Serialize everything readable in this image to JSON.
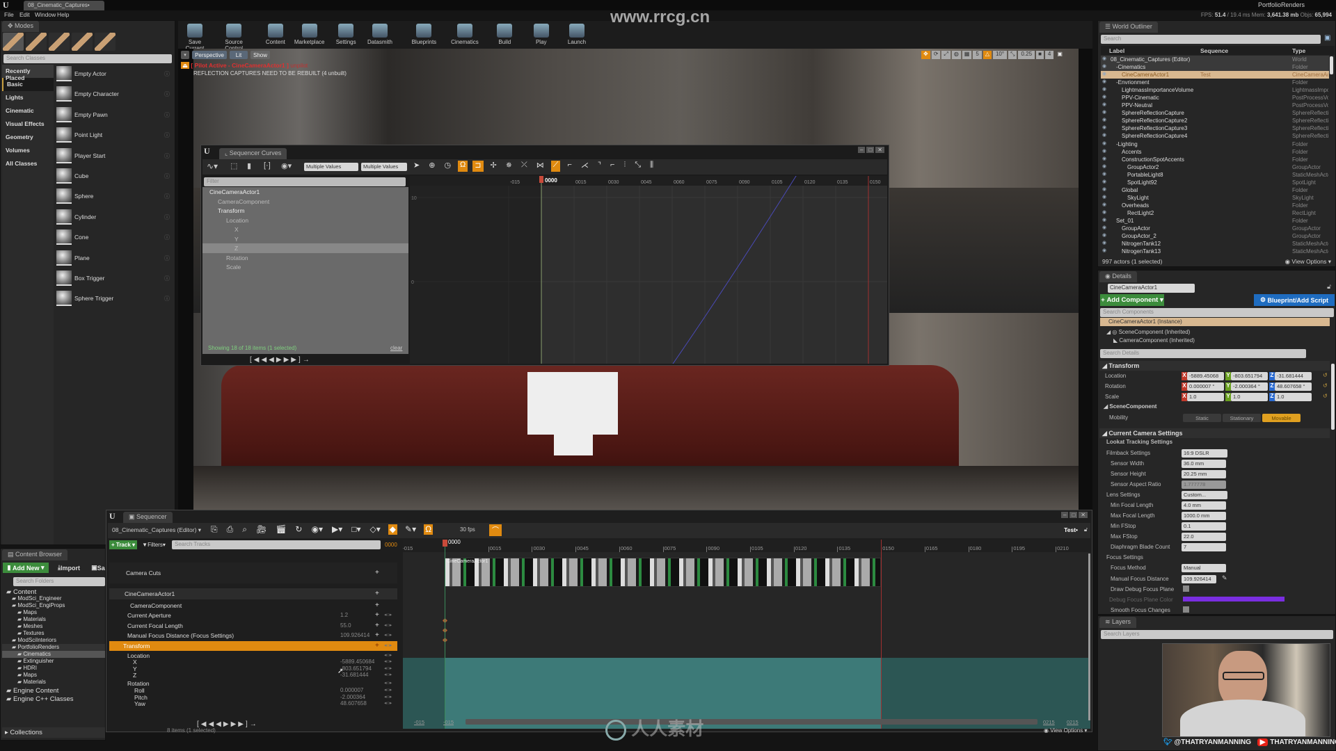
{
  "app": {
    "level_tab": "08_Cinematic_Captures•",
    "project": "PortfolioRenders",
    "watermark_url": "www.rrcg.cn",
    "watermark_brand": "人人素材",
    "stats": {
      "fps_label": "FPS:",
      "fps": "51.4",
      "ms": "/ 19.4 ms",
      "mem_label": "Mem:",
      "mem": "3,641.38 mb",
      "objs_label": "Objs:",
      "objs": "65,994"
    }
  },
  "menu": [
    "File",
    "Edit",
    "Window",
    "Help"
  ],
  "modes": {
    "tab": "Modes",
    "search_placeholder": "Search Classes",
    "categories": [
      "Recently Placed",
      "Basic",
      "Lights",
      "Cinematic",
      "Visual Effects",
      "Geometry",
      "Volumes",
      "All Classes"
    ],
    "selected_category": "Basic",
    "items": [
      "Empty Actor",
      "Empty Character",
      "Empty Pawn",
      "Point Light",
      "Player Start",
      "Cube",
      "Sphere",
      "Cylinder",
      "Cone",
      "Plane",
      "Box Trigger",
      "Sphere Trigger"
    ]
  },
  "toolbar": [
    "Save Current",
    "Source Control",
    "Content",
    "Marketplace",
    "Settings",
    "Datasmith",
    "Blueprints",
    "Cinematics",
    "Build",
    "Play",
    "Launch"
  ],
  "viewport": {
    "perspective": "Perspective",
    "lit": "Lit",
    "show": "Show",
    "pilot": "[ Pilot Active - CineCameraActor1 ]",
    "pilot_suffix": "unpilot",
    "warning": "REFLECTION CAPTURES NEED TO BE REBUILT (4 unbuilt)",
    "grid_snap": "5",
    "rot_snap": "10°",
    "scale_snap": "0.25",
    "cam_speed": "4"
  },
  "curves": {
    "tab": "Sequencer Curves",
    "value1": "Multiple Values",
    "value2": "Multiple Values",
    "filter_placeholder": "Filter",
    "tree": [
      "CineCameraActor1",
      "CameraComponent",
      "Transform",
      "Location",
      "X",
      "Y",
      "Z",
      "Rotation",
      "Scale"
    ],
    "status": "Showing 18 of 18 items (1 selected)",
    "clear": "clear",
    "playhead": "0000",
    "x_ticks": [
      "-015",
      "0015",
      "0030",
      "0045",
      "0060",
      "0075",
      "0090",
      "0105",
      "0120",
      "0135",
      "0150"
    ],
    "y_ticks": [
      "20",
      "10",
      "0",
      "-10",
      "-20",
      "-30"
    ],
    "curve_color": "#4a4ab8"
  },
  "sequencer": {
    "tab": "Sequencer",
    "sequence_name": "08_Cinematic_Captures (Editor)",
    "track_btn": "Track",
    "filters_btn": "Filters",
    "search_placeholder": "Search Tracks",
    "frame": "0000",
    "fps": "30 fps",
    "sequence": "Test•",
    "camera_cuts": "Camera Cuts",
    "actor": "CineCameraActor1",
    "component": "CameraComponent",
    "props": [
      {
        "name": "Current Aperture",
        "value": "1.2"
      },
      {
        "name": "Current Focal Length",
        "value": "55.0"
      },
      {
        "name": "Manual Focus Distance (Focus Settings)",
        "value": "109.926414"
      }
    ],
    "transform": "Transform",
    "location": "Location",
    "loc": [
      {
        "name": "X",
        "value": "-5889.450684"
      },
      {
        "name": "Y",
        "value": "-803.651794"
      },
      {
        "name": "Z",
        "value": "-31.681444"
      }
    ],
    "rotation": "Rotation",
    "rot": [
      {
        "name": "Roll",
        "value": "0.000007"
      },
      {
        "name": "Pitch",
        "value": "-2.000364"
      },
      {
        "name": "Yaw",
        "value": "48.607658"
      }
    ],
    "ticks": [
      "-015",
      "0015",
      "0030",
      "0045",
      "0060",
      "0075",
      "0090",
      "0105",
      "0120",
      "0135",
      "0150",
      "0165",
      "0180",
      "0195",
      "0210"
    ],
    "clip_label": "CineCameraActor1",
    "range_start": "-015",
    "range_view_start": "-015",
    "range_view_end": "0215",
    "range_end": "0215",
    "items_status": "8 items (1 selected)",
    "view_options": "View Options",
    "highlight_color": "#e08a10"
  },
  "content_browser": {
    "tab": "Content Browser",
    "add_new": "Add New",
    "import": "Import",
    "save": "Sa",
    "search_placeholder": "Search Folders",
    "tree": [
      {
        "label": "Content",
        "level": 0
      },
      {
        "label": "ModSci_Engineer",
        "level": 1
      },
      {
        "label": "ModSci_EngiProps",
        "level": 1
      },
      {
        "label": "Maps",
        "level": 2
      },
      {
        "label": "Materials",
        "level": 2
      },
      {
        "label": "Meshes",
        "level": 2
      },
      {
        "label": "Textures",
        "level": 2
      },
      {
        "label": "ModSciInteriors",
        "level": 1
      },
      {
        "label": "PortfolioRenders",
        "level": 1
      },
      {
        "label": "Cinematics",
        "level": 2
      },
      {
        "label": "Extinguisher",
        "level": 2
      },
      {
        "label": "HDRI",
        "level": 2
      },
      {
        "label": "Maps",
        "level": 2
      },
      {
        "label": "Materials",
        "level": 2
      },
      {
        "label": "Engine Content",
        "level": 0
      },
      {
        "label": "Engine C++ Classes",
        "level": 0
      }
    ],
    "selected": "Cinematics",
    "collections": "Collections"
  },
  "outliner": {
    "tab": "World Outliner",
    "search_placeholder": "Search",
    "columns": [
      "Label",
      "Sequence",
      "Type"
    ],
    "rows": [
      {
        "label": "08_Cinematic_Captures (Editor)",
        "seq": "",
        "type": "World",
        "level": 0
      },
      {
        "label": "-Cinematics",
        "seq": "",
        "type": "Folder",
        "level": 1
      },
      {
        "label": "CineCameraActor1",
        "seq": "Test",
        "type": "CineCameraActor",
        "level": 2
      },
      {
        "label": "-Envrionment",
        "seq": "",
        "type": "Folder",
        "level": 1
      },
      {
        "label": "LightmassImportanceVolume",
        "seq": "",
        "type": "LightmassImportanceVolume",
        "level": 2
      },
      {
        "label": "PPV-Cinematic",
        "seq": "",
        "type": "PostProcessVolume",
        "level": 2
      },
      {
        "label": "PPV-Neutral",
        "seq": "",
        "type": "PostProcessVolume",
        "level": 2
      },
      {
        "label": "SphereReflectionCapture",
        "seq": "",
        "type": "SphereReflectionCapture",
        "level": 2
      },
      {
        "label": "SphereReflectionCapture2",
        "seq": "",
        "type": "SphereReflectionCapture",
        "level": 2
      },
      {
        "label": "SphereReflectionCapture3",
        "seq": "",
        "type": "SphereReflectionCapture",
        "level": 2
      },
      {
        "label": "SphereReflectionCapture4",
        "seq": "",
        "type": "SphereReflectionCapture",
        "level": 2
      },
      {
        "label": "-Lighting",
        "seq": "",
        "type": "Folder",
        "level": 1
      },
      {
        "label": "Accents",
        "seq": "",
        "type": "Folder",
        "level": 2
      },
      {
        "label": "ConstructionSpotAccents",
        "seq": "",
        "type": "Folder",
        "level": 2
      },
      {
        "label": "GroupActor2",
        "seq": "",
        "type": "GroupActor",
        "level": 3
      },
      {
        "label": "PortableLight8",
        "seq": "",
        "type": "StaticMeshActor",
        "level": 3
      },
      {
        "label": "SpotLight92",
        "seq": "",
        "type": "SpotLight",
        "level": 3
      },
      {
        "label": "Global",
        "seq": "",
        "type": "Folder",
        "level": 2
      },
      {
        "label": "SkyLight",
        "seq": "",
        "type": "SkyLight",
        "level": 3
      },
      {
        "label": "Overheads",
        "seq": "",
        "type": "Folder",
        "level": 2
      },
      {
        "label": "RectLight2",
        "seq": "",
        "type": "RectLight",
        "level": 3
      },
      {
        "label": "Set_01",
        "seq": "",
        "type": "Folder",
        "level": 1
      },
      {
        "label": "GroupActor",
        "seq": "",
        "type": "GroupActor",
        "level": 2
      },
      {
        "label": "GroupActor_2",
        "seq": "",
        "type": "GroupActor",
        "level": 2
      },
      {
        "label": "NitrogenTank12",
        "seq": "",
        "type": "StaticMeshActor",
        "level": 2
      },
      {
        "label": "NitrogenTank13",
        "seq": "",
        "type": "StaticMeshActor",
        "level": 2
      }
    ],
    "selected": "CineCameraActor1",
    "status": "997 actors (1 selected)",
    "view_options": "View Options"
  },
  "details": {
    "tab": "Details",
    "name": "CineCameraActor1",
    "add_component": "Add Component",
    "blueprint": "Blueprint/Add Script",
    "search_components": "Search Components",
    "components": [
      "CineCameraActor1 (Instance)",
      "SceneComponent (Inherited)",
      "CameraComponent (Inherited)"
    ],
    "search_details": "Search Details",
    "transform": "Transform",
    "location_label": "Location",
    "location": [
      "-5889.45068",
      "-803.651794",
      "-31.681444"
    ],
    "rotation_label": "Rotation",
    "rotation": [
      "0.000007 °",
      "-2.000364 °",
      "48.607658 °"
    ],
    "scale_label": "Scale",
    "scale": [
      "1.0",
      "1.0",
      "1.0"
    ],
    "scene_component": "SceneComponent",
    "mobility_label": "Mobility",
    "mobility": [
      "Static",
      "Stationary",
      "Movable"
    ],
    "mobility_selected": "Movable",
    "camera_settings": "Current Camera Settings",
    "lookat": "Lookat Tracking Settings",
    "filmback": "Filmback Settings",
    "filmback_value": "16:9 DSLR",
    "sensor": [
      {
        "name": "Sensor Width",
        "value": "36.0 mm"
      },
      {
        "name": "Sensor Height",
        "value": "20.25 mm"
      },
      {
        "name": "Sensor Aspect Ratio",
        "value": "1.777778"
      }
    ],
    "lens": "Lens Settings",
    "lens_value": "Custom...",
    "lens_props": [
      {
        "name": "Min Focal Length",
        "value": "4.0 mm"
      },
      {
        "name": "Max Focal Length",
        "value": "1000.0 mm"
      },
      {
        "name": "Min FStop",
        "value": "0.1"
      },
      {
        "name": "Max FStop",
        "value": "22.0"
      },
      {
        "name": "Diaphragm Blade Count",
        "value": "7"
      }
    ],
    "focus": "Focus Settings",
    "focus_method_label": "Focus Method",
    "focus_method": "Manual",
    "focus_distance_label": "Manual Focus Distance",
    "focus_distance": "109.926414",
    "draw_debug": "Draw Debug Focus Plane",
    "debug_color_label": "Debug Focus Plane Color",
    "debug_color": "#7a2ee0",
    "smooth_focus": "Smooth Focus Changes"
  },
  "layers": {
    "tab": "Layers",
    "search_placeholder": "Search Layers"
  },
  "webcam": {
    "twitter": "@THATRYANMANNING",
    "youtube": "THATRYANMANNING"
  }
}
